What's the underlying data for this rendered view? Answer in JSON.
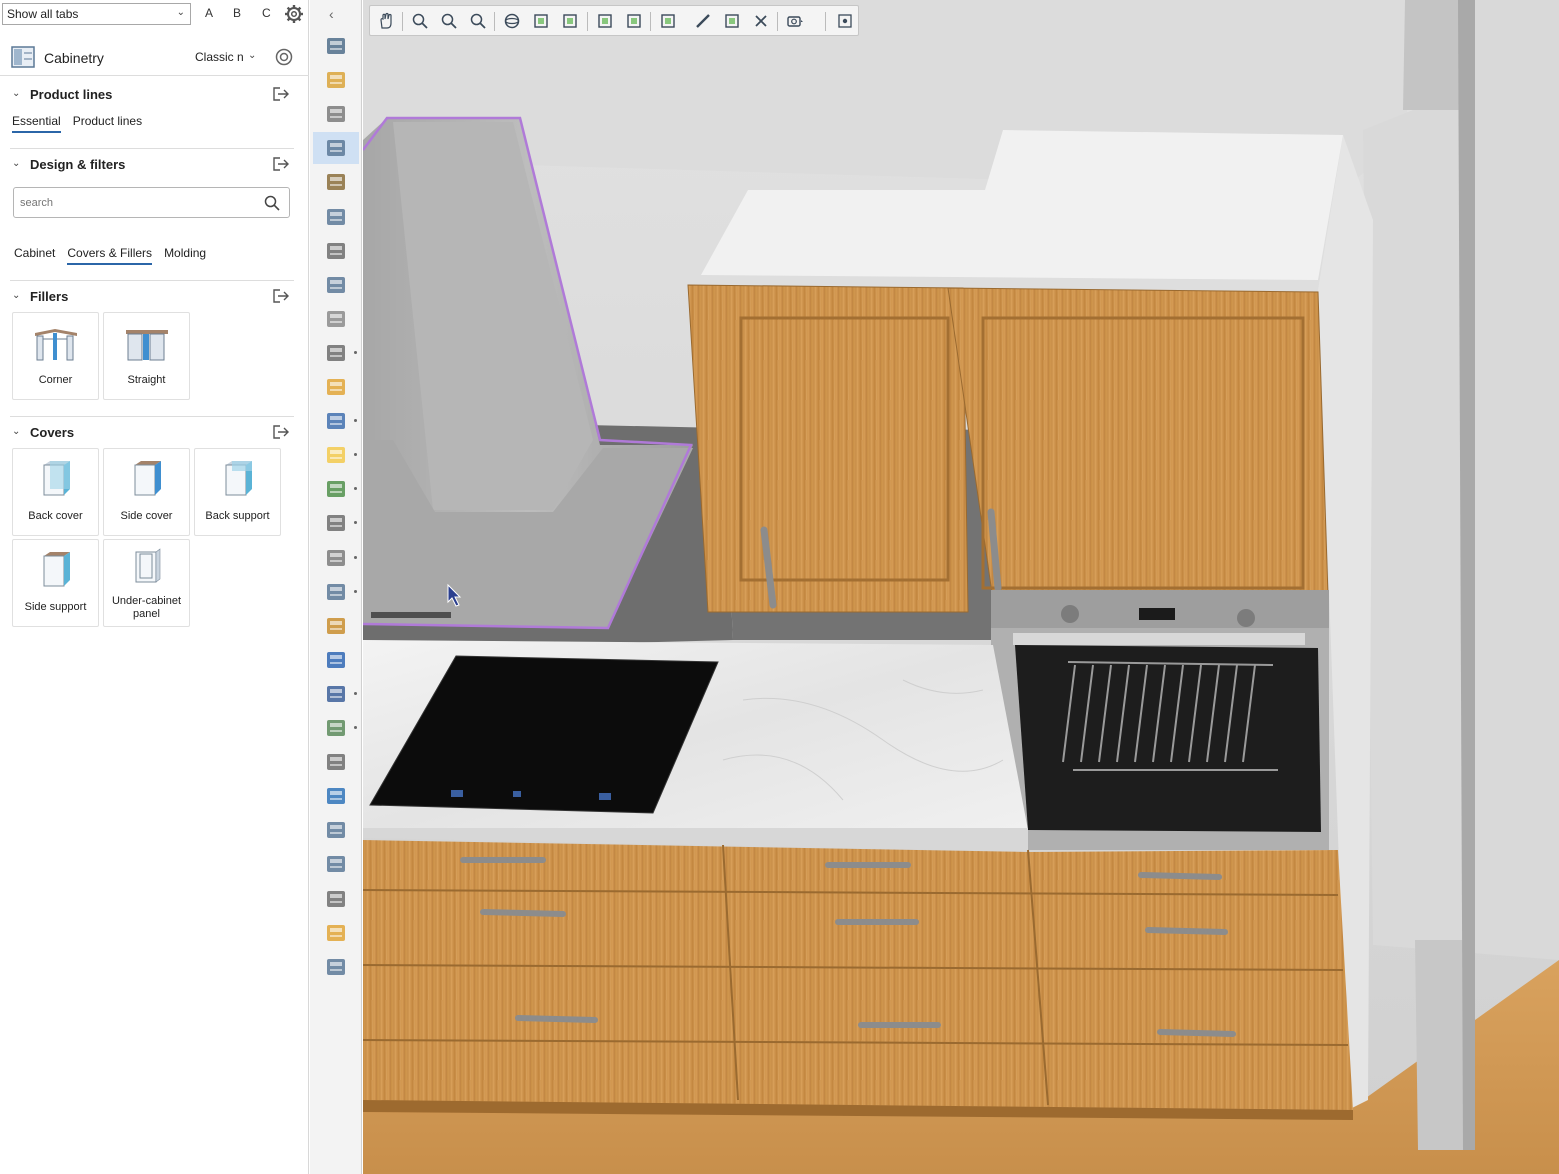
{
  "topbar": {
    "tabs_filter": "Show all tabs",
    "letters": [
      "A",
      "B",
      "C"
    ]
  },
  "catalog": {
    "title": "Cabinetry",
    "style": "Classic n"
  },
  "product_lines": {
    "title": "Product lines",
    "tabs": [
      "Essential",
      "Product lines"
    ],
    "active_tab": "Essential"
  },
  "design_filters": {
    "title": "Design & filters",
    "search_placeholder": "search",
    "tabs": [
      "Cabinet",
      "Covers & Fillers",
      "Molding"
    ],
    "active_tab": "Covers & Fillers"
  },
  "fillers": {
    "title": "Fillers",
    "items": [
      "Corner",
      "Straight"
    ]
  },
  "covers": {
    "title": "Covers",
    "items": [
      "Back cover",
      "Side cover",
      "Back support",
      "Side support",
      "Under-cabinet panel"
    ]
  },
  "vertical_toolbar": {
    "selected_index": 3,
    "icons": [
      "cooking-pot-icon",
      "tools-icon",
      "wall-brick-icon",
      "cabinetry-icon",
      "arch-icon",
      "counter-icon",
      "faucet-icon",
      "appliance-tower-icon",
      "sink-icon",
      "cup-icon",
      "floorplan-icon",
      "people-icon",
      "lightbulb-icon",
      "plant-icon",
      "house-icon",
      "lamp-icon",
      "facade-icon",
      "pdf-box-icon",
      "v-logo-icon",
      "flag-icon",
      "cube-gear-icon",
      "camera-flash-icon",
      "3d-box-icon",
      "catalog-book-icon",
      "printer-icon",
      "pdf-chart-icon",
      "folder-icon",
      "zoom-icon"
    ]
  },
  "view_toolbar": {
    "icons": [
      "pan-hand-icon",
      "zoom-in-icon",
      "zoom-window-icon",
      "zoom-extents-icon",
      "orbit-icon",
      "fit-selection-icon",
      "view-box-icon",
      "select-arrow-icon",
      "select-edit-icon",
      "dimension-icon",
      "measure-ruler-icon",
      "copy-icon",
      "delete-x-icon",
      "camera-dropdown-icon",
      "center-target-icon"
    ]
  },
  "colors": {
    "accent": "#2b66a8",
    "wood": "#c98f46",
    "worktop": "#ececec",
    "hob": "#0c0c0c",
    "selection_outline": "#b07ad8",
    "floor": "#d49a55"
  }
}
